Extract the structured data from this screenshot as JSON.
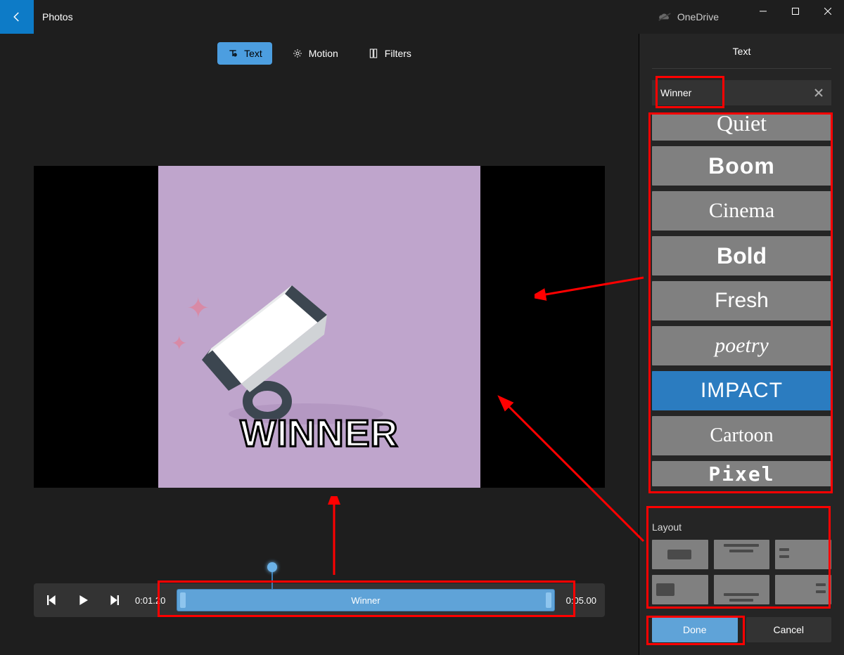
{
  "app": {
    "title": "Photos",
    "onedrive": "OneDrive"
  },
  "tabs": {
    "text": "Text",
    "motion": "Motion",
    "filters": "Filters"
  },
  "overlay": {
    "text_upper": "WINNER"
  },
  "timeline": {
    "start": "0:01.20",
    "end": "0:05.00",
    "clip_label": "Winner"
  },
  "panel": {
    "title": "Text",
    "input_value": "Winner",
    "styles": {
      "quiet": "Quiet",
      "boom": "Boom",
      "cinema": "Cinema",
      "bold": "Bold",
      "fresh": "Fresh",
      "poetry": "poetry",
      "impact": "IMPACT",
      "cartoon": "Cartoon",
      "pixel": "Pixel"
    },
    "layout_label": "Layout",
    "done": "Done",
    "cancel": "Cancel"
  }
}
